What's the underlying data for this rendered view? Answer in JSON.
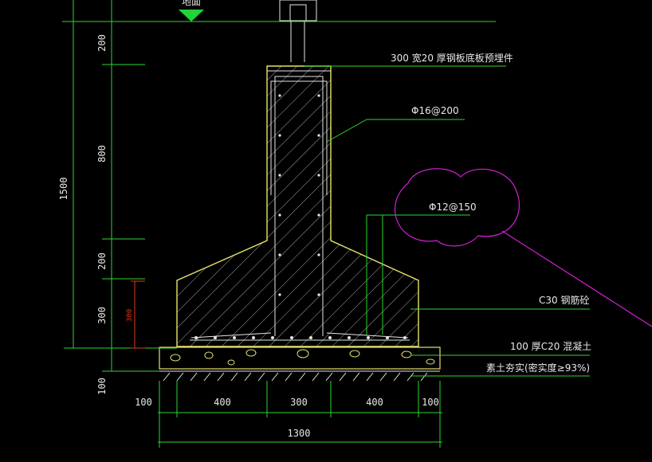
{
  "colors": {
    "background": "#000000",
    "dimension_lines": "#2fd62f",
    "concrete_outline": "#e8e36a",
    "rebar": "#e6e6e6",
    "revision_cloud": "#d21fd2",
    "red_dimension": "#e03a1a",
    "text": "#e8e8e8"
  },
  "top_label": "地面",
  "vertical_dimensions": {
    "total": "1500",
    "segments": [
      "200",
      "800",
      "200",
      "300",
      "100"
    ],
    "red_segment": "300"
  },
  "horizontal_dimensions": {
    "segments": [
      "100",
      "400",
      "300",
      "400",
      "100"
    ],
    "total": "1300"
  },
  "annotations": {
    "embedded_plate": "300  宽20  厚钢板底板预埋件",
    "column_rebar": "Φ16@200",
    "base_rebar": "Φ12@150",
    "concrete": "C30  钢筋砼",
    "cushion": "100  厚C20  混凝土",
    "soil": "素土夯实(密实度≥93%)"
  },
  "icons": {
    "ground_marker": "ground-level-triangle-icon",
    "revision": "revision-cloud-icon"
  }
}
